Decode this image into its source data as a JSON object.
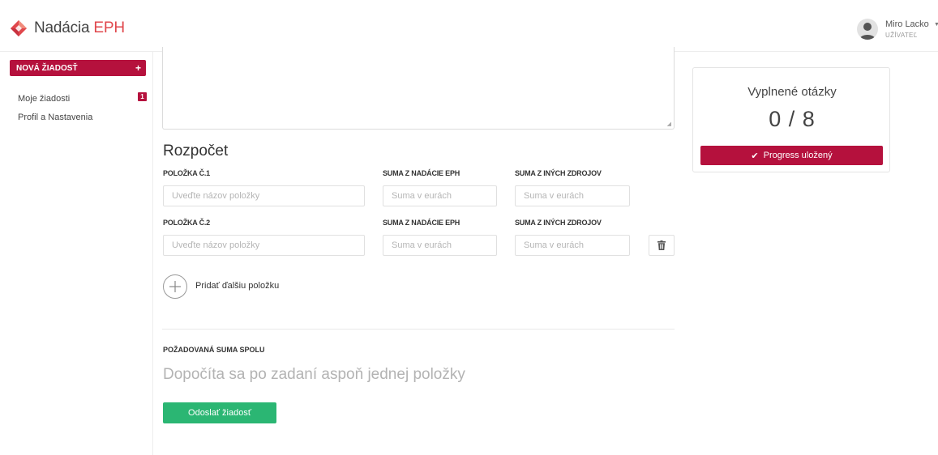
{
  "header": {
    "logo_main": "Nadácia ",
    "logo_accent": "EPH",
    "user_name": "Miro Lacko",
    "user_role": "UŽÍVATEĽ",
    "caret_icon": "caret-down-icon"
  },
  "sidebar": {
    "new_request_label": "NOVÁ ŽIADOSŤ",
    "new_request_plus": "+",
    "items": [
      {
        "label": "Moje žiadosti",
        "badge": "1"
      },
      {
        "label": "Profil a Nastavenia"
      }
    ]
  },
  "budget": {
    "title": "Rozpočet",
    "rows": [
      {
        "item_label": "POLOŽKA Č.1",
        "eph_label": "SUMA Z NADÁCIE EPH",
        "other_label": "SUMA Z INÝCH ZDROJOV",
        "name_placeholder": "Uveďte názov položky",
        "eph_placeholder": "Suma v eurách",
        "other_placeholder": "Suma v eurách"
      },
      {
        "item_label": "POLOŽKA Č.2",
        "eph_label": "SUMA Z NADÁCIE EPH",
        "other_label": "SUMA Z INÝCH ZDROJOV",
        "name_placeholder": "Uveďte názov položky",
        "eph_placeholder": "Suma v eurách",
        "other_placeholder": "Suma v eurách"
      }
    ],
    "add_item_label": "Pridať ďalšiu položku",
    "total_label": "POŽADOVANÁ SUMA SPOLU",
    "total_value": "Dopočíta sa po zadaní aspoň jednej položky",
    "submit_label": "Odoslať žiadosť"
  },
  "progress": {
    "title": "Vyplnené otázky",
    "count": "0 / 8",
    "saved_label": "Progress uložený"
  },
  "colors": {
    "brand": "#b5113d",
    "logo_accent": "#e0474c",
    "submit": "#2bb673"
  }
}
